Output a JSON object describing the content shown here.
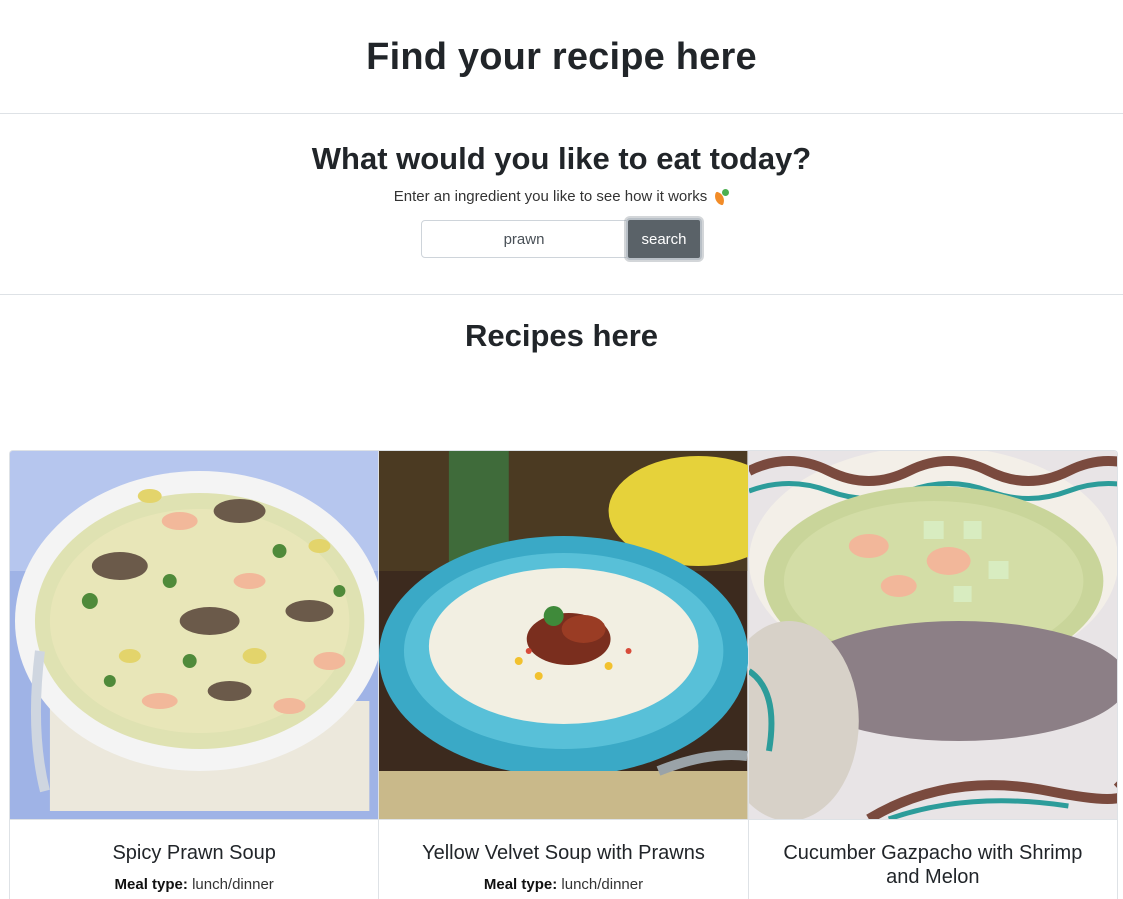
{
  "header": {
    "title": "Find your recipe here"
  },
  "search": {
    "heading": "What would you like to eat today?",
    "subtitle": "Enter an ingredient you like to see how it works",
    "subtitle_icon": "carrot-icon",
    "input_value": "prawn",
    "button_label": "search"
  },
  "results": {
    "heading": "Recipes here",
    "meal_type_label": "Meal type:",
    "cards": [
      {
        "title": "Spicy Prawn Soup",
        "meal_type": "lunch/dinner",
        "image": "bowl of noodle soup with prawns and mushrooms"
      },
      {
        "title": "Yellow Velvet Soup with Prawns",
        "meal_type": "lunch/dinner",
        "image": "creamy soup in blue bowl topped with prawns"
      },
      {
        "title": "Cucumber Gazpacho with Shrimp and Melon",
        "meal_type": "",
        "image": "green gazpacho in patterned bowl with shrimp"
      }
    ]
  },
  "colors": {
    "button_bg": "#5a6268",
    "border": "#dee2e6",
    "text": "#212529"
  }
}
